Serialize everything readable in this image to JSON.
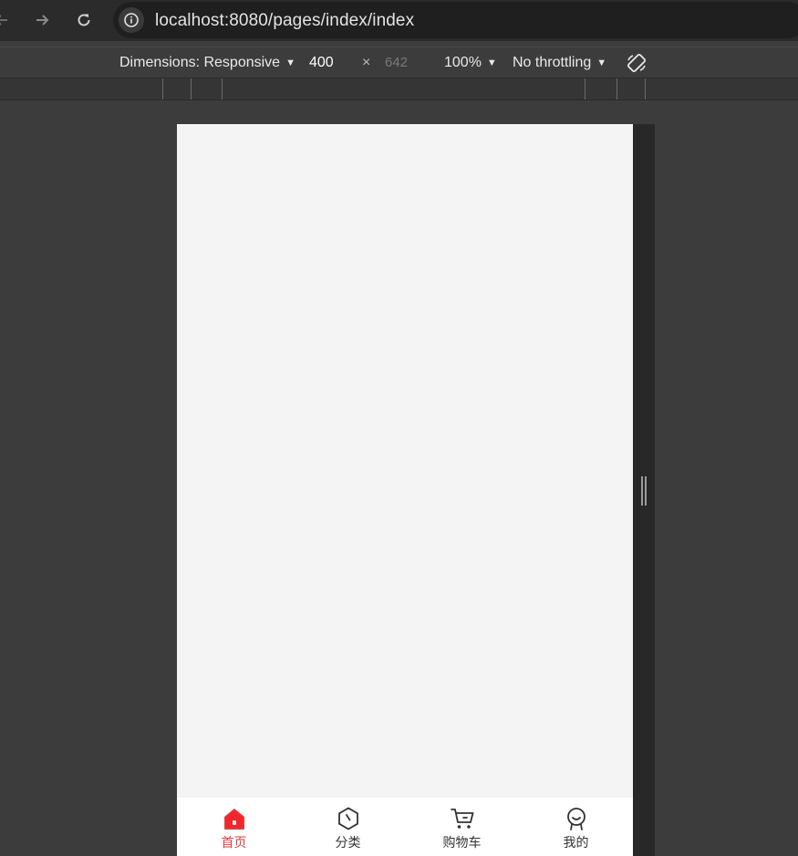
{
  "browser": {
    "url_host": "localhost",
    "url_rest": ":8080/pages/index/index"
  },
  "device_toolbar": {
    "dimensions_label": "Dimensions: Responsive",
    "width": "400",
    "times": "×",
    "height": "642",
    "zoom": "100%",
    "throttling": "No throttling"
  },
  "tabbar": {
    "items": [
      {
        "label": "首页",
        "icon": "home-icon",
        "active": true
      },
      {
        "label": "分类",
        "icon": "category-icon",
        "active": false
      },
      {
        "label": "购物车",
        "icon": "cart-icon",
        "active": false
      },
      {
        "label": "我的",
        "icon": "profile-icon",
        "active": false
      }
    ],
    "active_color": "#e4393c",
    "inactive_color": "#333333"
  }
}
